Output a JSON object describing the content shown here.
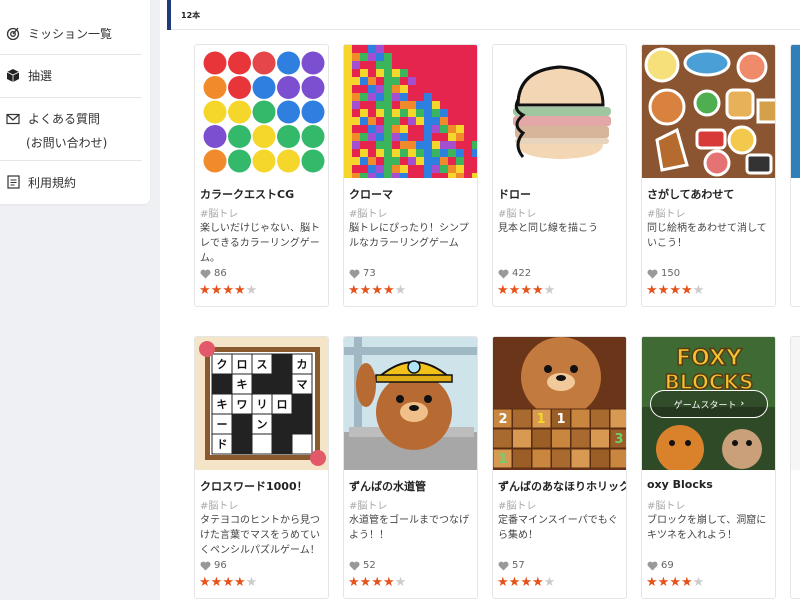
{
  "sidebar": {
    "items": [
      {
        "label": "ミッション一覧",
        "icon": "target-icon"
      },
      {
        "label": "抽選",
        "icon": "box-icon"
      },
      {
        "label": "よくある質問",
        "label2": "(お問い合わせ)",
        "icon": "mail-icon"
      },
      {
        "label": "利用規約",
        "icon": "document-icon"
      }
    ]
  },
  "header": {
    "count": "12本"
  },
  "tag": "#脳トレ",
  "games": [
    {
      "title": "カラークエストCG",
      "desc": "楽しいだけじゃない、脳トレできるカラーリングゲーム。",
      "likes": "86",
      "rating": 4
    },
    {
      "title": "クローマ",
      "desc": "脳トレにぴったり！シンプルなカラーリングゲーム",
      "likes": "73",
      "rating": 4
    },
    {
      "title": "ドロー",
      "desc": "見本と同じ線を描こう",
      "likes": "422",
      "rating": 4
    },
    {
      "title": "さがしてあわせて",
      "desc": "同じ絵柄をあわせて消していこう！",
      "likes": "150",
      "rating": 4
    },
    {
      "title": "クロスワード1000！",
      "desc": "タテヨコのヒントから見つけた言葉でマスをうめていくペンシルパズルゲーム！",
      "likes": "96",
      "rating": 4
    },
    {
      "title": "ずんばの水道管",
      "desc": "水道管をゴールまでつなげよう！！",
      "likes": "52",
      "rating": 4
    },
    {
      "title": "ずんばのあなほりホリック",
      "desc": "定番マインスイーパでもぐら集め！",
      "likes": "57",
      "rating": 4
    },
    {
      "title": "oxy Blocks",
      "desc": "ブロックを崩して、洞窟にキツネを入れよう！",
      "likes": "69",
      "rating": 4
    }
  ],
  "crossword_chars": [
    "ク",
    "ロ",
    "ス",
    "カ",
    "キ",
    "マ",
    "キ",
    "ワ",
    "リ",
    "ロ",
    "ー",
    "ン",
    "ド"
  ],
  "foxy_title": [
    "FOXY",
    "BLOCKS"
  ],
  "start_button": "ゲームスタート",
  "colors": {
    "accent": "#e5531c",
    "header_blue": "#1f3b7a"
  }
}
